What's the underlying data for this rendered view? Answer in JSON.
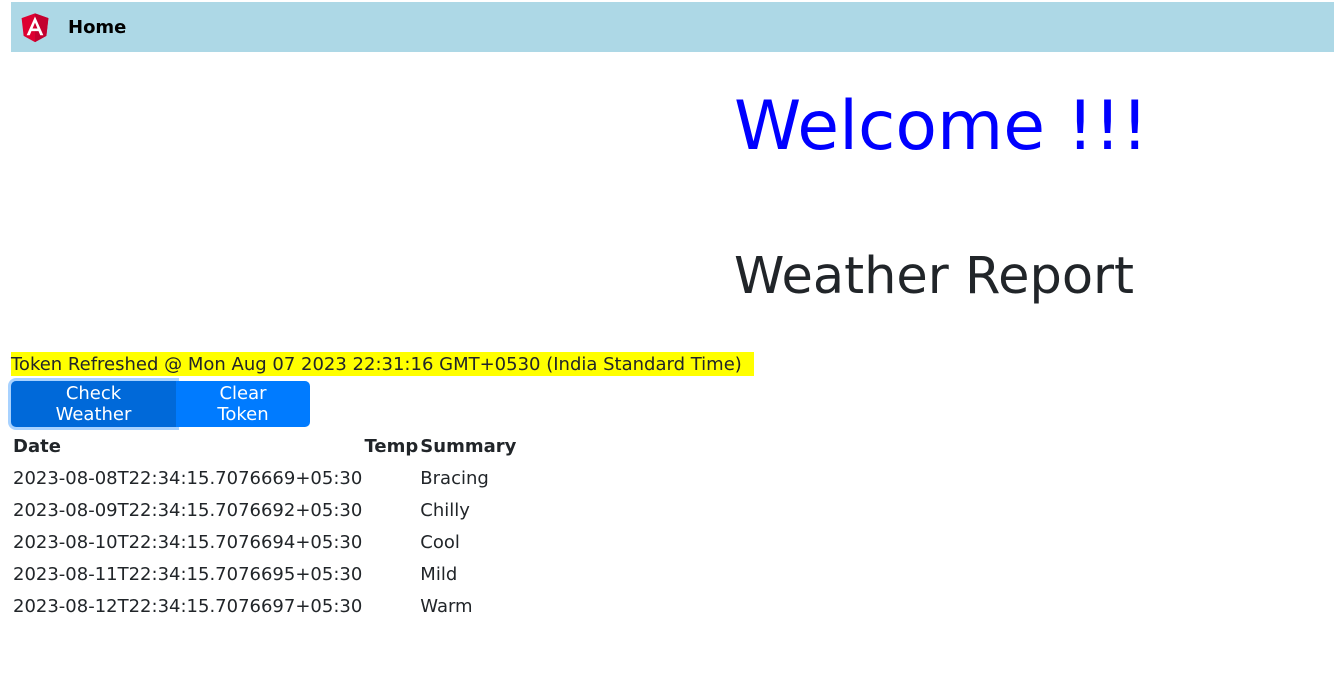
{
  "colors": {
    "navbar_bg": "#add8e6",
    "welcome_text": "#0000ff",
    "highlight": "#ffff00",
    "button_primary": "#007bff",
    "button_active": "#0069d9",
    "logo_red": "#dd0031",
    "logo_dark_red": "#c3002f"
  },
  "navbar": {
    "logo_icon": "angular-logo",
    "home_label": "Home"
  },
  "welcome": {
    "text": "Welcome !!!"
  },
  "report": {
    "title": "Weather Report"
  },
  "token": {
    "text": "Token Refreshed @ Mon Aug 07 2023 22:31:16 GMT+0530 (India Standard Time)"
  },
  "buttons": {
    "check_weather": "Check Weather",
    "clear_token": "Clear Token"
  },
  "table": {
    "headers": {
      "date": "Date",
      "temp": "Temp",
      "summary": "Summary"
    },
    "rows": [
      {
        "date": "2023-08-08T22:34:15.7076669+05:30",
        "temp": "",
        "summary": "Bracing"
      },
      {
        "date": "2023-08-09T22:34:15.7076692+05:30",
        "temp": "",
        "summary": "Chilly"
      },
      {
        "date": "2023-08-10T22:34:15.7076694+05:30",
        "temp": "",
        "summary": "Cool"
      },
      {
        "date": "2023-08-11T22:34:15.7076695+05:30",
        "temp": "",
        "summary": "Mild"
      },
      {
        "date": "2023-08-12T22:34:15.7076697+05:30",
        "temp": "",
        "summary": "Warm"
      }
    ]
  }
}
